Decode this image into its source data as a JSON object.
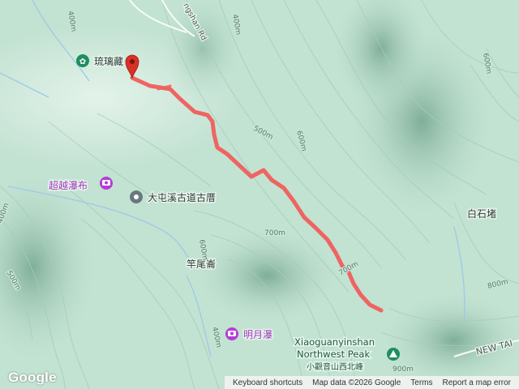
{
  "map": {
    "pois": [
      {
        "id": "liuli",
        "label": "琉璃藏",
        "icon": "flower-icon",
        "color": "#1e8e5e"
      },
      {
        "id": "chaoyue",
        "label": "超越瀑布",
        "icon": "camera-icon",
        "color": "#b63bd6"
      },
      {
        "id": "datun",
        "label": "大屯溪古道古厝",
        "icon": "place-icon",
        "color": "#6b7780"
      },
      {
        "id": "ganwei",
        "label": "竿尾崙",
        "icon": "none",
        "color": "#2f3b36"
      },
      {
        "id": "baishi",
        "label": "白石堵",
        "icon": "none",
        "color": "#2f3b36"
      },
      {
        "id": "mingyue",
        "label": "明月瀑",
        "icon": "camera-icon",
        "color": "#b63bd6"
      }
    ],
    "peak": {
      "line1": "Xiaoguanyinshan",
      "line2": "Northwest Peak",
      "line3": "小觀音山西北峰",
      "icon": "mountain-peak-icon"
    },
    "road_labels": [
      "ngshan Rd",
      "NEW TAI"
    ],
    "contour_labels": [
      "400m",
      "400m",
      "500m",
      "600m",
      "600m",
      "700m",
      "700m",
      "800m",
      "400m",
      "500m",
      "600m",
      "400m",
      "900m"
    ],
    "route_color": "#ef6461",
    "marker_color": "#d93025"
  },
  "footer": {
    "logo": "Google",
    "keyboard": "Keyboard shortcuts",
    "mapdata": "Map data ©2026 Google",
    "terms": "Terms",
    "report": "Report a map error"
  }
}
